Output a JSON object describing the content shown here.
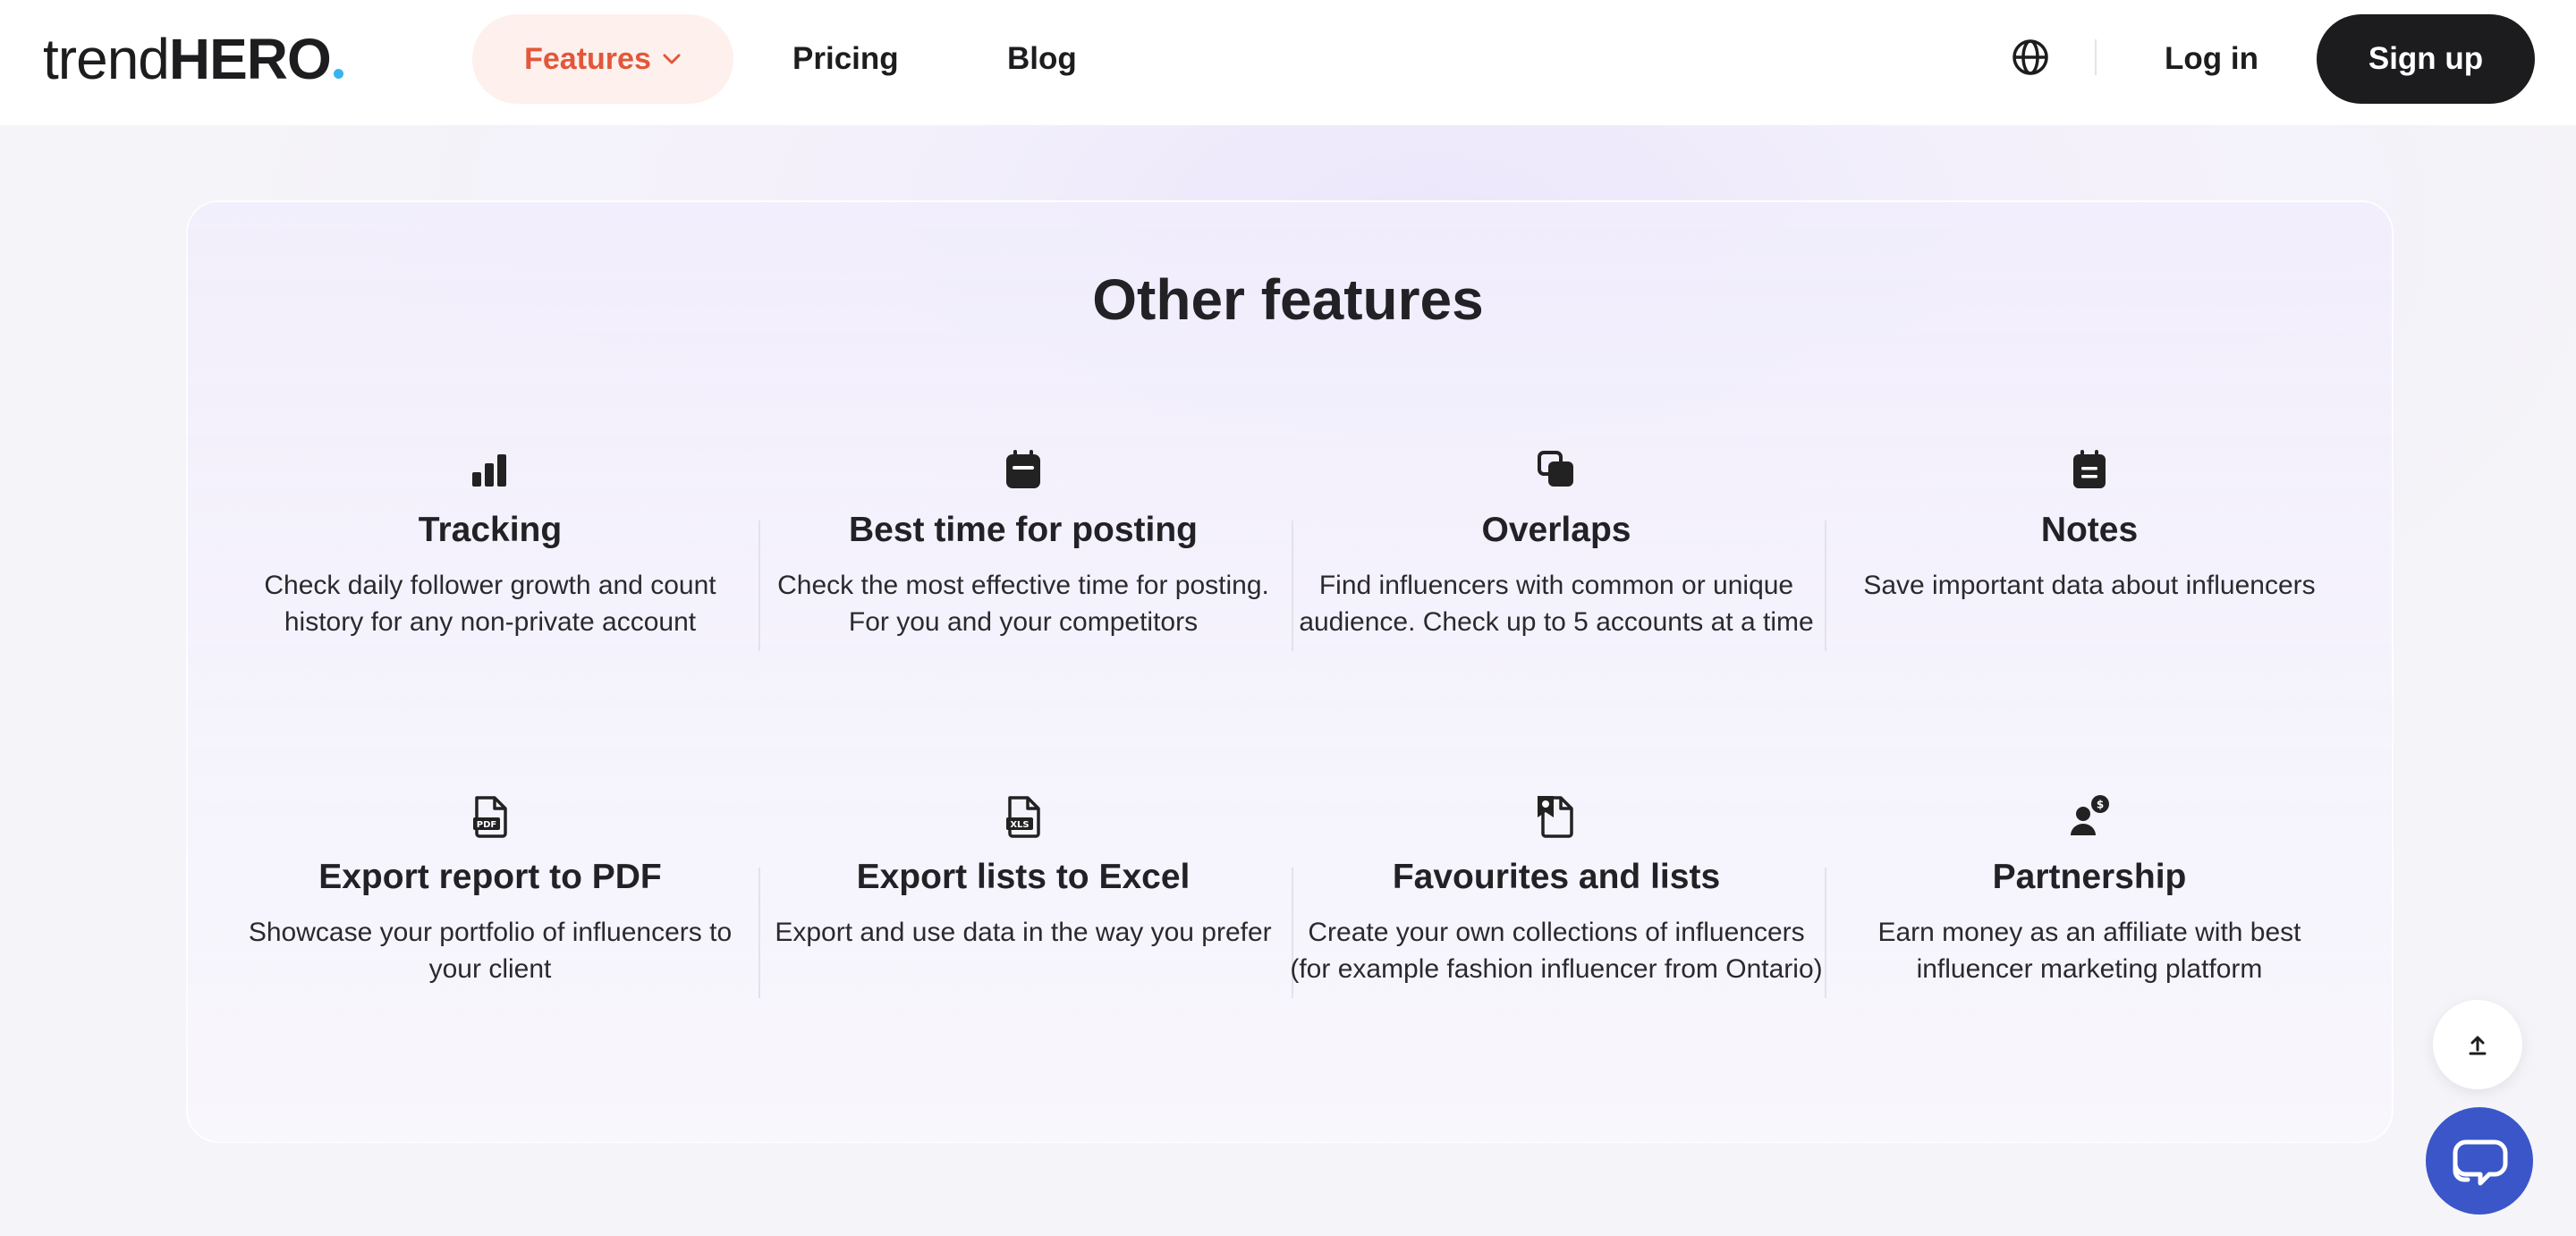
{
  "header": {
    "logo_light": "trend",
    "logo_bold": "HERO",
    "nav": {
      "features": "Features",
      "pricing": "Pricing",
      "blog": "Blog"
    },
    "login": "Log in",
    "signup": "Sign up"
  },
  "section": {
    "title": "Other features",
    "features": [
      {
        "icon": "bar-chart-icon",
        "title": "Tracking",
        "desc": "Check daily follower growth and count history for any non-private account"
      },
      {
        "icon": "calendar-icon",
        "title": "Best time for posting",
        "desc": "Check the most effective time for posting. For you and your competitors"
      },
      {
        "icon": "overlap-icon",
        "title": "Overlaps",
        "desc": "Find influencers with common or unique audience. Check up to 5 accounts at a time"
      },
      {
        "icon": "notes-icon",
        "title": "Notes",
        "desc": "Save important data about influencers"
      },
      {
        "icon": "pdf-file-icon",
        "title": "Export report to PDF",
        "desc": "Showcase your portfolio of influencers to your client",
        "badge": "PDF"
      },
      {
        "icon": "xls-file-icon",
        "title": "Export lists to Excel",
        "desc": "Export and use data in the way you prefer",
        "badge": "XLS"
      },
      {
        "icon": "favourites-icon",
        "title": "Favourites and lists",
        "desc": "Create your own collections of influencers (for example fashion influencer from Ontario)"
      },
      {
        "icon": "partnership-icon",
        "title": "Partnership",
        "desc": "Earn money as an affiliate with best influencer marketing platform",
        "badge": "$"
      }
    ]
  },
  "colors": {
    "accent": "#e2573a",
    "accent_bg": "#fdf0ed",
    "dark": "#1c1c1e",
    "chat": "#3a56c8",
    "logo_dot": "#38b3ef"
  }
}
